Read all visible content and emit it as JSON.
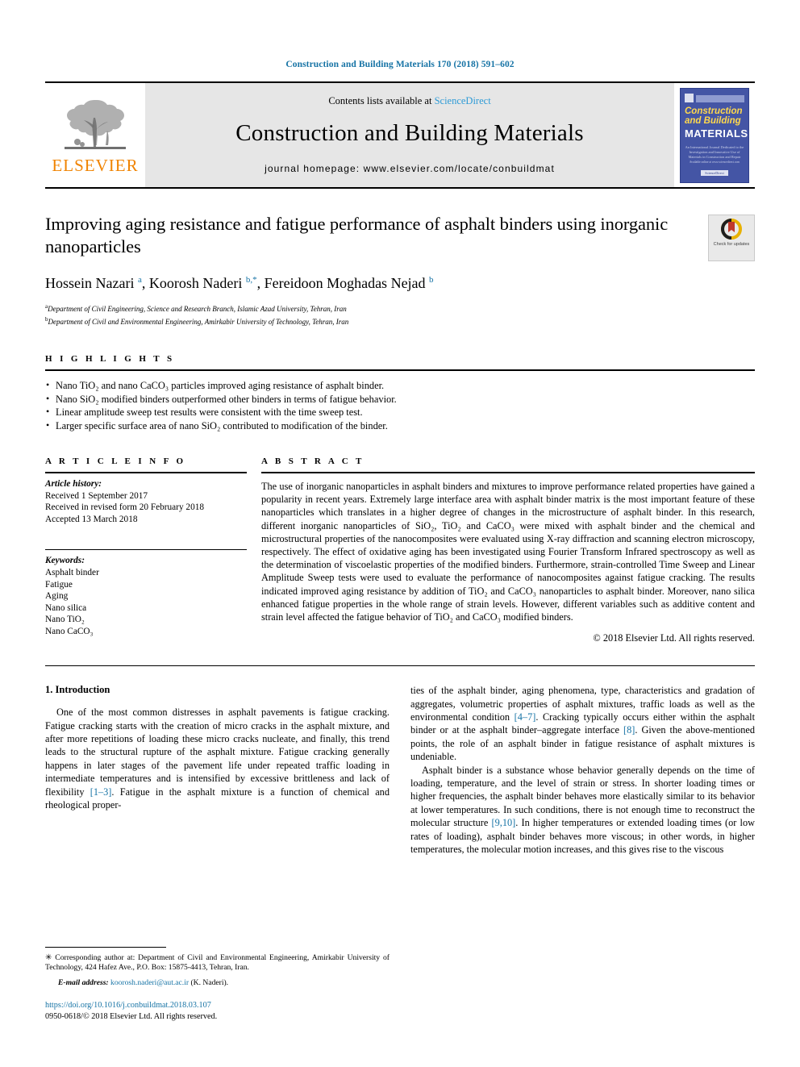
{
  "running_head": "Construction and Building Materials 170 (2018) 591–602",
  "masthead": {
    "publisher_name": "ELSEVIER",
    "contents_prefix": "Contents lists available at ",
    "contents_link": "ScienceDirect",
    "journal_title": "Construction and Building Materials",
    "homepage": "journal homepage: www.elsevier.com/locate/conbuildmat",
    "cover": {
      "line1": "Construction",
      "line2": "and Building",
      "line3": "MATERIALS",
      "blurb": "An International Journal Dedicated to the Investigation and Innovative Use of Materials in Construction and Repair",
      "foot_small": "Available online at www.sciencedirect.com",
      "foot_badge": "ScienceDirect"
    }
  },
  "article": {
    "title": "Improving aging resistance and fatigue performance of asphalt binders using inorganic nanoparticles",
    "authors_html": "Hossein Nazari <sup>a</sup>, Koorosh Naderi <sup>b,</sup><sup>*</sup>, Fereidoon Moghadas Nejad <sup>b</sup>",
    "affiliations": [
      {
        "marker": "a",
        "text": "Department of Civil Engineering, Science and Research Branch, Islamic Azad University, Tehran, Iran"
      },
      {
        "marker": "b",
        "text": "Department of Civil and Environmental Engineering, Amirkabir University of Technology, Tehran, Iran"
      }
    ],
    "crossmark_label": "Check for updates"
  },
  "highlights": {
    "heading": "H I G H L I G H T S",
    "items": [
      "Nano TiO₂ and nano CaCO₃ particles improved aging resistance of asphalt binder.",
      "Nano SiO₂ modified binders outperformed other binders in terms of fatigue behavior.",
      "Linear amplitude sweep test results were consistent with the time sweep test.",
      "Larger specific surface area of nano SiO₂ contributed to modification of the binder."
    ]
  },
  "article_info": {
    "heading": "A R T I C L E   I N F O",
    "history_label": "Article history:",
    "history": [
      "Received 1 September 2017",
      "Received in revised form 20 February 2018",
      "Accepted 13 March 2018"
    ],
    "keywords_label": "Keywords:",
    "keywords": [
      "Asphalt binder",
      "Fatigue",
      "Aging",
      "Nano silica",
      "Nano TiO₂",
      "Nano CaCO₃"
    ]
  },
  "abstract": {
    "heading": "A B S T R A C T",
    "text": "The use of inorganic nanoparticles in asphalt binders and mixtures to improve performance related properties have gained a popularity in recent years. Extremely large interface area with asphalt binder matrix is the most important feature of these nanoparticles which translates in a higher degree of changes in the microstructure of asphalt binder. In this research, different inorganic nanoparticles of SiO₂, TiO₂ and CaCO₃ were mixed with asphalt binder and the chemical and microstructural properties of the nanocomposites were evaluated using X-ray diffraction and scanning electron microscopy, respectively. The effect of oxidative aging has been investigated using Fourier Transform Infrared spectroscopy as well as the determination of viscoelastic properties of the modified binders. Furthermore, strain-controlled Time Sweep and Linear Amplitude Sweep tests were used to evaluate the performance of nanocomposites against fatigue cracking. The results indicated improved aging resistance by addition of TiO₂ and CaCO₃ nanoparticles to asphalt binder. Moreover, nano silica enhanced fatigue properties in the whole range of strain levels. However, different variables such as additive content and strain level affected the fatigue behavior of TiO₂ and CaCO₃ modified binders.",
    "copyright": "© 2018 Elsevier Ltd. All rights reserved."
  },
  "introduction": {
    "heading": "1. Introduction",
    "left_paragraph_1_html": "One of the most common distresses in asphalt pavements is fatigue cracking. Fatigue cracking starts with the creation of micro cracks in the asphalt mixture, and after more repetitions of loading these micro cracks nucleate, and finally, this trend leads to the structural rupture of the asphalt mixture. Fatigue cracking generally happens in later stages of the pavement life under repeated traffic loading in intermediate temperatures and is intensified by excessive brittleness and lack of flexibility <span class=\"ref\">[1&#8211;3]</span>. Fatigue in the asphalt mixture is a function of chemical and rheological proper-",
    "right_paragraph_1_html": "ties of the asphalt binder, aging phenomena, type, characteristics and gradation of aggregates, volumetric properties of asphalt mixtures, traffic loads as well as the environmental condition <span class=\"ref\">[4&#8211;7]</span>. Cracking typically occurs either within the asphalt binder or at the asphalt binder&#8211;aggregate interface <span class=\"ref\">[8]</span>. Given the above-mentioned points, the role of an asphalt binder in fatigue resistance of asphalt mixtures is undeniable.",
    "right_paragraph_2_html": "Asphalt binder is a substance whose behavior generally depends on the time of loading, temperature, and the level of strain or stress. In shorter loading times or higher frequencies, the asphalt binder behaves more elastically similar to its behavior at lower temperatures. In such conditions, there is not enough time to reconstruct the molecular structure <span class=\"ref\">[9,10]</span>. In higher temperatures or extended loading times (or low rates of loading), asphalt binder behaves more viscous; in other words, in higher temperatures, the molecular motion increases, and this gives rise to the viscous"
  },
  "footnotes": {
    "corresponding_html": "<span class=\"star\">&#10035;</span> Corresponding author at: Department of Civil and Environmental Engineering, Amirkabir University of Technology, 424 Hafez Ave., P.O. Box: 15875-4413, Tehran, Iran.",
    "email_label": "E-mail address:",
    "email": "koorosh.naderi@aut.ac.ir",
    "email_owner": "(K. Naderi)."
  },
  "footer": {
    "doi": "https://doi.org/10.1016/j.conbuildmat.2018.03.107",
    "issn_line": "0950-0618/© 2018 Elsevier Ltd. All rights reserved."
  },
  "colors": {
    "link_blue": "#1673a5",
    "sciencedirect_blue": "#2e9bd6",
    "elsevier_orange": "#f08300",
    "band_gray": "#e6e6e6"
  }
}
